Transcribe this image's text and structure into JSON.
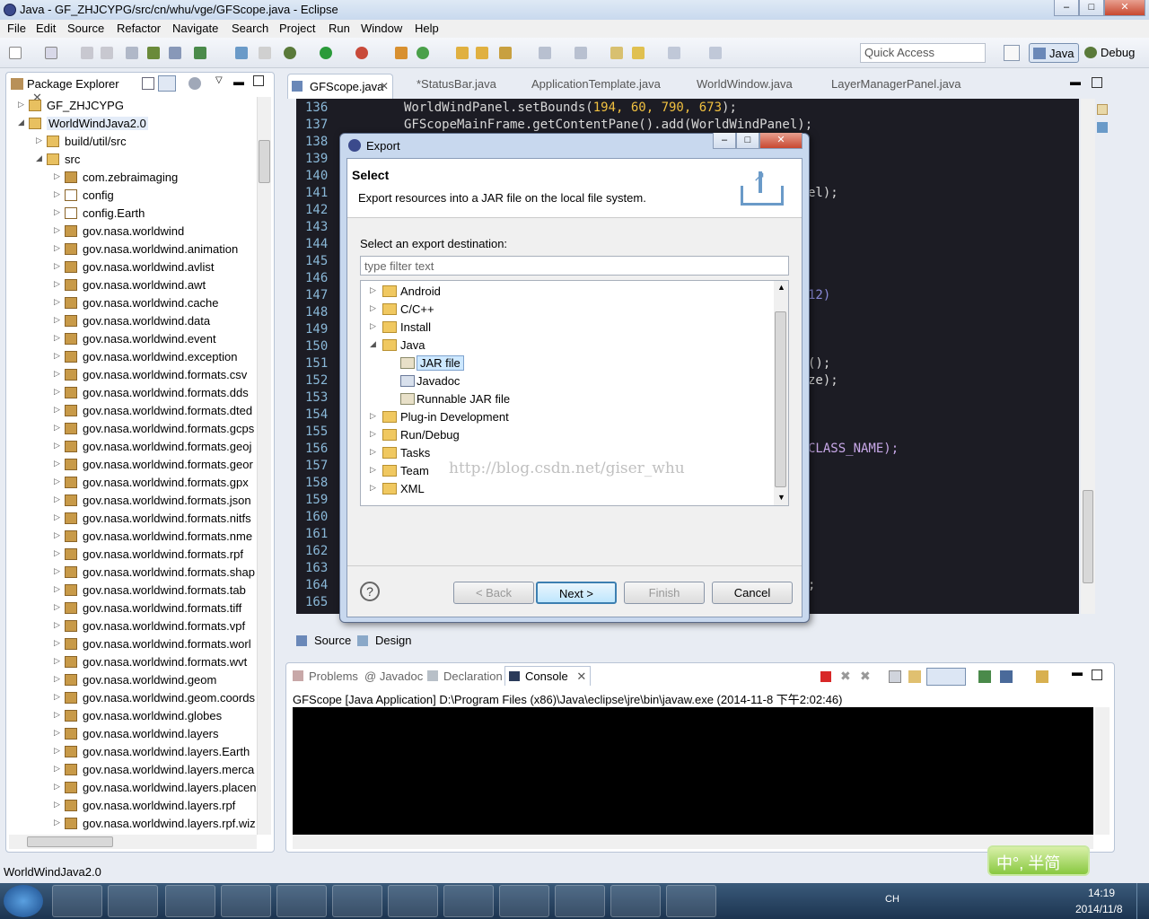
{
  "window": {
    "title": "Java - GF_ZHJCYPG/src/cn/whu/vge/GFScope.java - Eclipse"
  },
  "menu": [
    "File",
    "Edit",
    "Source",
    "Refactor",
    "Navigate",
    "Search",
    "Project",
    "Run",
    "Window",
    "Help"
  ],
  "quick_access": {
    "placeholder": "Quick Access"
  },
  "perspectives": {
    "java": "Java",
    "debug": "Debug"
  },
  "package_explorer": {
    "tab": "Package Explorer",
    "items": [
      {
        "label": "GF_ZHJCYPG",
        "level": 0,
        "kind": "project",
        "expanded": false
      },
      {
        "label": "WorldWindJava2.0",
        "level": 0,
        "kind": "project",
        "expanded": true
      },
      {
        "label": "build/util/src",
        "level": 1,
        "kind": "folder",
        "expanded": false
      },
      {
        "label": "src",
        "level": 1,
        "kind": "folder",
        "expanded": true
      },
      {
        "label": "com.zebraimaging",
        "level": 2,
        "kind": "package"
      },
      {
        "label": "config",
        "level": 2,
        "kind": "package-empty"
      },
      {
        "label": "config.Earth",
        "level": 2,
        "kind": "package-empty"
      },
      {
        "label": "gov.nasa.worldwind",
        "level": 2,
        "kind": "package"
      },
      {
        "label": "gov.nasa.worldwind.animation",
        "level": 2,
        "kind": "package"
      },
      {
        "label": "gov.nasa.worldwind.avlist",
        "level": 2,
        "kind": "package"
      },
      {
        "label": "gov.nasa.worldwind.awt",
        "level": 2,
        "kind": "package"
      },
      {
        "label": "gov.nasa.worldwind.cache",
        "level": 2,
        "kind": "package"
      },
      {
        "label": "gov.nasa.worldwind.data",
        "level": 2,
        "kind": "package"
      },
      {
        "label": "gov.nasa.worldwind.event",
        "level": 2,
        "kind": "package"
      },
      {
        "label": "gov.nasa.worldwind.exception",
        "level": 2,
        "kind": "package"
      },
      {
        "label": "gov.nasa.worldwind.formats.csv",
        "level": 2,
        "kind": "package"
      },
      {
        "label": "gov.nasa.worldwind.formats.dds",
        "level": 2,
        "kind": "package"
      },
      {
        "label": "gov.nasa.worldwind.formats.dted",
        "level": 2,
        "kind": "package"
      },
      {
        "label": "gov.nasa.worldwind.formats.gcps",
        "level": 2,
        "kind": "package"
      },
      {
        "label": "gov.nasa.worldwind.formats.geoj",
        "level": 2,
        "kind": "package"
      },
      {
        "label": "gov.nasa.worldwind.formats.geor",
        "level": 2,
        "kind": "package"
      },
      {
        "label": "gov.nasa.worldwind.formats.gpx",
        "level": 2,
        "kind": "package"
      },
      {
        "label": "gov.nasa.worldwind.formats.json",
        "level": 2,
        "kind": "package"
      },
      {
        "label": "gov.nasa.worldwind.formats.nitfs",
        "level": 2,
        "kind": "package"
      },
      {
        "label": "gov.nasa.worldwind.formats.nme",
        "level": 2,
        "kind": "package"
      },
      {
        "label": "gov.nasa.worldwind.formats.rpf",
        "level": 2,
        "kind": "package"
      },
      {
        "label": "gov.nasa.worldwind.formats.shap",
        "level": 2,
        "kind": "package"
      },
      {
        "label": "gov.nasa.worldwind.formats.tab",
        "level": 2,
        "kind": "package"
      },
      {
        "label": "gov.nasa.worldwind.formats.tiff",
        "level": 2,
        "kind": "package"
      },
      {
        "label": "gov.nasa.worldwind.formats.vpf",
        "level": 2,
        "kind": "package"
      },
      {
        "label": "gov.nasa.worldwind.formats.worl",
        "level": 2,
        "kind": "package"
      },
      {
        "label": "gov.nasa.worldwind.formats.wvt",
        "level": 2,
        "kind": "package"
      },
      {
        "label": "gov.nasa.worldwind.geom",
        "level": 2,
        "kind": "package"
      },
      {
        "label": "gov.nasa.worldwind.geom.coords",
        "level": 2,
        "kind": "package"
      },
      {
        "label": "gov.nasa.worldwind.globes",
        "level": 2,
        "kind": "package"
      },
      {
        "label": "gov.nasa.worldwind.layers",
        "level": 2,
        "kind": "package"
      },
      {
        "label": "gov.nasa.worldwind.layers.Earth",
        "level": 2,
        "kind": "package"
      },
      {
        "label": "gov.nasa.worldwind.layers.merca",
        "level": 2,
        "kind": "package"
      },
      {
        "label": "gov.nasa.worldwind.layers.placen",
        "level": 2,
        "kind": "package"
      },
      {
        "label": "gov.nasa.worldwind.layers.rpf",
        "level": 2,
        "kind": "package"
      },
      {
        "label": "gov.nasa.worldwind.layers.rpf.wiz",
        "level": 2,
        "kind": "package"
      }
    ]
  },
  "editor": {
    "tabs": [
      "GFScope.java",
      "*StatusBar.java",
      "ApplicationTemplate.java",
      "WorldWindow.java",
      "LayerManagerPanel.java"
    ],
    "line_numbers": [
      "136",
      "137",
      "138",
      "139",
      "140",
      "141",
      "142",
      "143",
      "144",
      "145",
      "146",
      "147",
      "148",
      "149",
      "150",
      "151",
      "152",
      "153",
      "154",
      "155",
      "156",
      "157",
      "158",
      "159",
      "160",
      "161",
      "162",
      "163",
      "164",
      "165"
    ],
    "code_136_a": "WorldWindPanel.setBounds(",
    "code_136_nums": "194, 60, 790, 673",
    "code_136_b": ");",
    "code_137": "GFScopeMainFrame.getContentPane().add(WorldWindPanel);",
    "code_141": "el);",
    "code_147": "12)",
    "code_151": "();",
    "code_152": "ze);",
    "code_156": "CLASS_NAME);",
    "code_164": ";",
    "bottom_tabs": {
      "source": "Source",
      "design": "Design"
    }
  },
  "console": {
    "tabs": [
      "Problems",
      "Javadoc",
      "Declaration",
      "Console"
    ],
    "info": "GFScope [Java Application] D:\\Program Files (x86)\\Java\\eclipse\\jre\\bin\\javaw.exe (2014-11-8 下午2:02:46)"
  },
  "dialog": {
    "title": "Export",
    "header_title": "Select",
    "header_desc": "Export resources into a JAR file on the local file system.",
    "destination_label": "Select an export destination:",
    "filter_placeholder": "type filter text",
    "tree": [
      {
        "label": "Android",
        "level": 0,
        "kind": "folder",
        "expanded": false
      },
      {
        "label": "C/C++",
        "level": 0,
        "kind": "folder",
        "expanded": false
      },
      {
        "label": "Install",
        "level": 0,
        "kind": "folder",
        "expanded": false
      },
      {
        "label": "Java",
        "level": 0,
        "kind": "folder",
        "expanded": true
      },
      {
        "label": "JAR file",
        "level": 1,
        "kind": "jar",
        "selected": true
      },
      {
        "label": "Javadoc",
        "level": 1,
        "kind": "doc"
      },
      {
        "label": "Runnable JAR file",
        "level": 1,
        "kind": "jar"
      },
      {
        "label": "Plug-in Development",
        "level": 0,
        "kind": "folder",
        "expanded": false
      },
      {
        "label": "Run/Debug",
        "level": 0,
        "kind": "folder",
        "expanded": false
      },
      {
        "label": "Tasks",
        "level": 0,
        "kind": "folder",
        "expanded": false
      },
      {
        "label": "Team",
        "level": 0,
        "kind": "folder",
        "expanded": false
      },
      {
        "label": "XML",
        "level": 0,
        "kind": "folder",
        "expanded": false
      }
    ],
    "buttons": {
      "back": "< Back",
      "next": "Next >",
      "finish": "Finish",
      "cancel": "Cancel"
    },
    "help_glyph": "?"
  },
  "watermark": "http://blog.csdn.net/giser_whu",
  "ime": "中°, 半简",
  "status": {
    "text": "WorldWindJava2.0"
  },
  "taskbar": {
    "lang": "CH",
    "time": "14:19",
    "date": "2014/11/8"
  },
  "colors": {
    "editor_bg": "#1c1c24",
    "selection": "#cde8ff",
    "keyword_number": "#f0c040"
  }
}
